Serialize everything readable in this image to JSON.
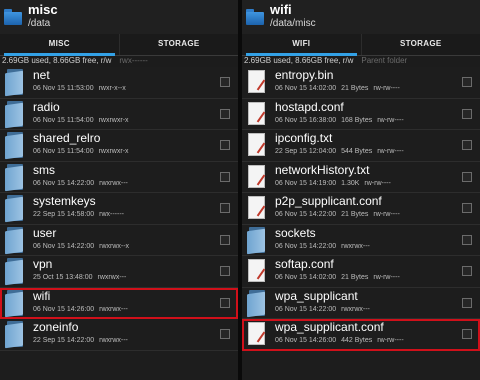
{
  "left": {
    "title": "misc",
    "path": "/data",
    "tabs": [
      "MISC",
      "STORAGE"
    ],
    "status": "2.69GB used, 8.66GB free, r/w",
    "status_ghost": "rwx------",
    "items": [
      {
        "name": "net",
        "date": "06 Nov 15 11:53:00",
        "size": "",
        "perms": "rwxr-x--x",
        "type": "folder"
      },
      {
        "name": "radio",
        "date": "06 Nov 15 11:54:00",
        "size": "",
        "perms": "rwxrwxr-x",
        "type": "folder"
      },
      {
        "name": "shared_relro",
        "date": "06 Nov 15 11:54:00",
        "size": "",
        "perms": "rwxrwxr-x",
        "type": "folder"
      },
      {
        "name": "sms",
        "date": "06 Nov 15 14:22:00",
        "size": "",
        "perms": "rwxrwx---",
        "type": "folder"
      },
      {
        "name": "systemkeys",
        "date": "22 Sep 15 14:58:00",
        "size": "",
        "perms": "rwx------",
        "type": "folder"
      },
      {
        "name": "user",
        "date": "06 Nov 15 14:22:00",
        "size": "",
        "perms": "rwxrwx--x",
        "type": "folder"
      },
      {
        "name": "vpn",
        "date": "25 Oct 15 13:48:00",
        "size": "",
        "perms": "rwxrwx---",
        "type": "folder"
      },
      {
        "name": "wifi",
        "date": "06 Nov 15 14:26:00",
        "size": "",
        "perms": "rwxrwx---",
        "type": "folder",
        "highlight": true
      },
      {
        "name": "zoneinfo",
        "date": "22 Sep 15 14:22:00",
        "size": "",
        "perms": "rwxrwx---",
        "type": "folder"
      }
    ]
  },
  "right": {
    "title": "wifi",
    "path": "/data/misc",
    "tabs": [
      "WIFI",
      "STORAGE"
    ],
    "status": "2.69GB used, 8.66GB free, r/w",
    "status_ghost": "Parent folder",
    "items": [
      {
        "name": "entropy.bin",
        "date": "06 Nov 15 14:02:00",
        "size": "21 Bytes",
        "perms": "rw-rw----",
        "type": "file"
      },
      {
        "name": "hostapd.conf",
        "date": "06 Nov 15 16:38:00",
        "size": "168 Bytes",
        "perms": "rw-rw----",
        "type": "file"
      },
      {
        "name": "ipconfig.txt",
        "date": "22 Sep 15 12:04:00",
        "size": "544 Bytes",
        "perms": "rw-rw----",
        "type": "file"
      },
      {
        "name": "networkHistory.txt",
        "date": "06 Nov 15 14:19:00",
        "size": "1.30K",
        "perms": "rw-rw----",
        "type": "file"
      },
      {
        "name": "p2p_supplicant.conf",
        "date": "06 Nov 15 14:22:00",
        "size": "21 Bytes",
        "perms": "rw-rw----",
        "type": "file"
      },
      {
        "name": "sockets",
        "date": "06 Nov 15 14:22:00",
        "size": "",
        "perms": "rwxrwx---",
        "type": "folder"
      },
      {
        "name": "softap.conf",
        "date": "06 Nov 15 14:02:00",
        "size": "21 Bytes",
        "perms": "rw-rw----",
        "type": "file"
      },
      {
        "name": "wpa_supplicant",
        "date": "06 Nov 15 14:22:00",
        "size": "",
        "perms": "rwxrwx---",
        "type": "folder"
      },
      {
        "name": "wpa_supplicant.conf",
        "date": "06 Nov 15 14:26:00",
        "size": "442 Bytes",
        "perms": "rw-rw----",
        "type": "file",
        "highlight": true
      }
    ]
  },
  "colors": {
    "accent": "#33a1e6",
    "highlight": "#d0101a",
    "folder": "#2e7cc9"
  }
}
